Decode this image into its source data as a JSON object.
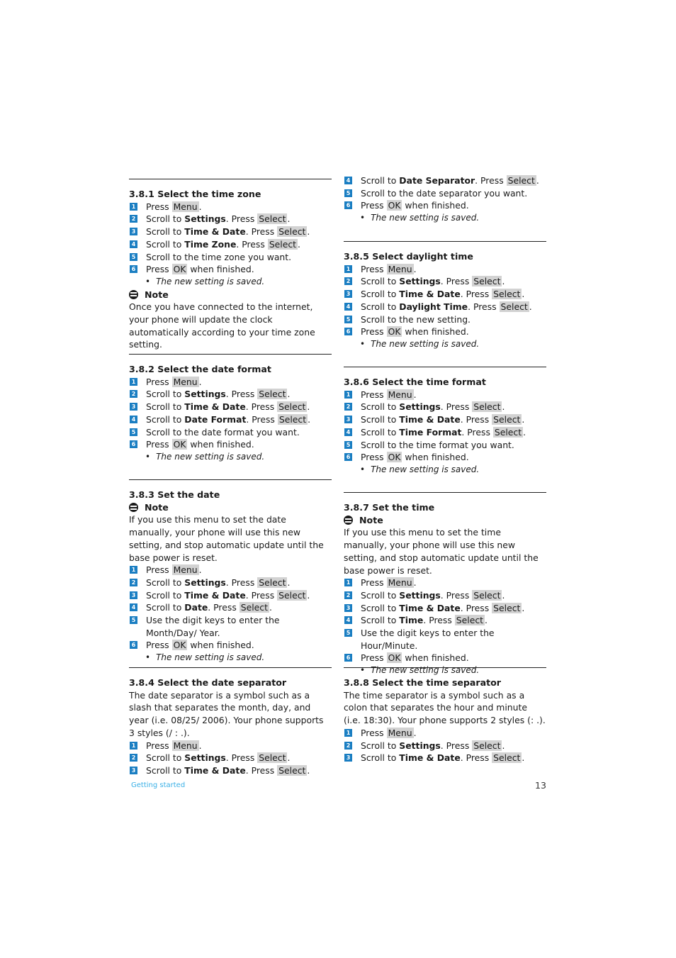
{
  "colors": {
    "step_badge": "#1a7ec2",
    "key_bg": "#d2d2d2",
    "footer_link": "#3ab0e6"
  },
  "keys": {
    "menu": "Menu",
    "select": "Select",
    "ok": "OK"
  },
  "common": {
    "press": "Press",
    "scroll_to": "Scroll to",
    "press_mid": ". Press",
    "when_finished": "when finished.",
    "saved": "The new setting is saved.",
    "note": "Note",
    "settings": "Settings",
    "time_date": "Time & Date"
  },
  "sections": {
    "s381": {
      "title": "3.8.1  Select the time zone",
      "step4_bold": "Time Zone",
      "step5": "Scroll to the time zone you want.",
      "note_text": "Once you have connected to the internet, your phone will update the clock automatically according to your time zone setting."
    },
    "s382": {
      "title": "3.8.2  Select the date format",
      "step4_bold": "Date Format",
      "step5": "Scroll to the date format you want."
    },
    "s383": {
      "title": "3.8.3  Set the date",
      "note_text": "If you use this menu to set the date manually, your phone will use this new setting, and stop automatic update until the base power is reset.",
      "step4_bold": "Date",
      "step5": "Use the digit keys to enter the Month/Day/ Year."
    },
    "s384": {
      "title": "3.8.4  Select the date separator",
      "intro": "The date separator is a symbol such as a slash that separates the month, day, and year (i.e. 08/25/ 2006). Your phone supports 3 styles (/  :  .).",
      "step4_bold": "Date Separator",
      "step5": "Scroll to the date separator you want."
    },
    "s385": {
      "title": "3.8.5  Select daylight time",
      "step4_bold": "Daylight Time",
      "step5": "Scroll to the new setting."
    },
    "s386": {
      "title": "3.8.6  Select the time format",
      "step4_bold": "Time Format",
      "step5": "Scroll to the time format you want."
    },
    "s387": {
      "title": "3.8.7  Set the time",
      "note_text": "If you use this menu to set the time manually, your phone will use this new setting, and stop automatic update until the base power is reset.",
      "step4_bold": "Time",
      "step5": "Use the digit keys to enter the Hour/Minute."
    },
    "s388": {
      "title": "3.8.8  Select the time separator",
      "intro": "The time separator is a symbol such as a colon that separates the hour and minute (i.e. 18:30). Your phone supports 2 styles (:  .)."
    }
  },
  "step_numbers": [
    "1",
    "2",
    "3",
    "4",
    "5",
    "6"
  ],
  "footer": {
    "section": "Getting started",
    "page": "13"
  }
}
